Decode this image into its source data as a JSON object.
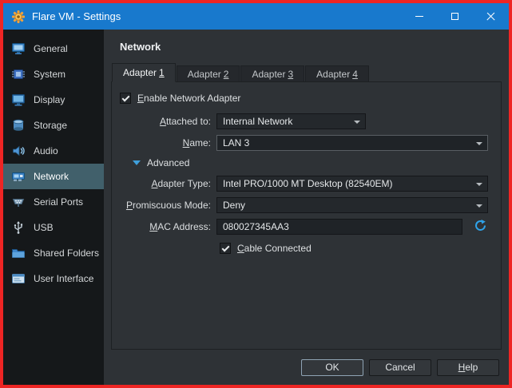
{
  "window": {
    "title": "Flare VM - Settings"
  },
  "colors": {
    "window_border": "#ee2524",
    "titlebar": "#1879cd",
    "sidebar_selection": "#41606b",
    "accent_blue": "#2fa2e8"
  },
  "icons": {
    "app": "gear",
    "window_controls": [
      "minimize",
      "maximize",
      "close"
    ],
    "sidebar": [
      "vm-monitor",
      "chip",
      "monitor",
      "disk",
      "speaker",
      "network-card",
      "serial-plug",
      "usb-connector",
      "folder",
      "window"
    ],
    "combo_arrow": "chevron-down",
    "advanced_toggle": "triangle-down",
    "mac_refresh": "circular-arrows"
  },
  "sidebar": {
    "items": [
      {
        "label": "General"
      },
      {
        "label": "System"
      },
      {
        "label": "Display"
      },
      {
        "label": "Storage"
      },
      {
        "label": "Audio"
      },
      {
        "label": "Network",
        "selected": true
      },
      {
        "label": "Serial Ports"
      },
      {
        "label": "USB"
      },
      {
        "label": "Shared Folders"
      },
      {
        "label": "User Interface"
      }
    ]
  },
  "main": {
    "title": "Network",
    "tabs": [
      {
        "text": "Adapter",
        "num": "1",
        "active": true
      },
      {
        "text": "Adapter",
        "num": "2",
        "active": false
      },
      {
        "text": "Adapter",
        "num": "3",
        "active": false
      },
      {
        "text": "Adapter",
        "num": "4",
        "active": false
      }
    ],
    "enable_checkbox": {
      "key": "E",
      "rest": "nable Network Adapter",
      "checked": true
    },
    "fields": {
      "attached_to": {
        "key": "A",
        "rest": "ttached to:",
        "value": "Internal Network"
      },
      "name": {
        "key": "N",
        "rest": "ame:",
        "value": "LAN 3"
      },
      "advanced": {
        "label": "Advanced",
        "expanded": true
      },
      "adapter_type": {
        "key": "A",
        "rest": "dapter Type:",
        "value": "Intel PRO/1000 MT Desktop (82540EM)"
      },
      "promiscuous": {
        "key": "P",
        "rest": "romiscuous Mode:",
        "value": "Deny"
      },
      "mac": {
        "key": "M",
        "rest": "AC Address:",
        "value": "080027345AA3"
      }
    },
    "cable_checkbox": {
      "key": "C",
      "rest": "able Connected",
      "checked": true
    }
  },
  "footer": {
    "ok": "OK",
    "cancel": "Cancel",
    "help_key": "H",
    "help_rest": "elp"
  }
}
